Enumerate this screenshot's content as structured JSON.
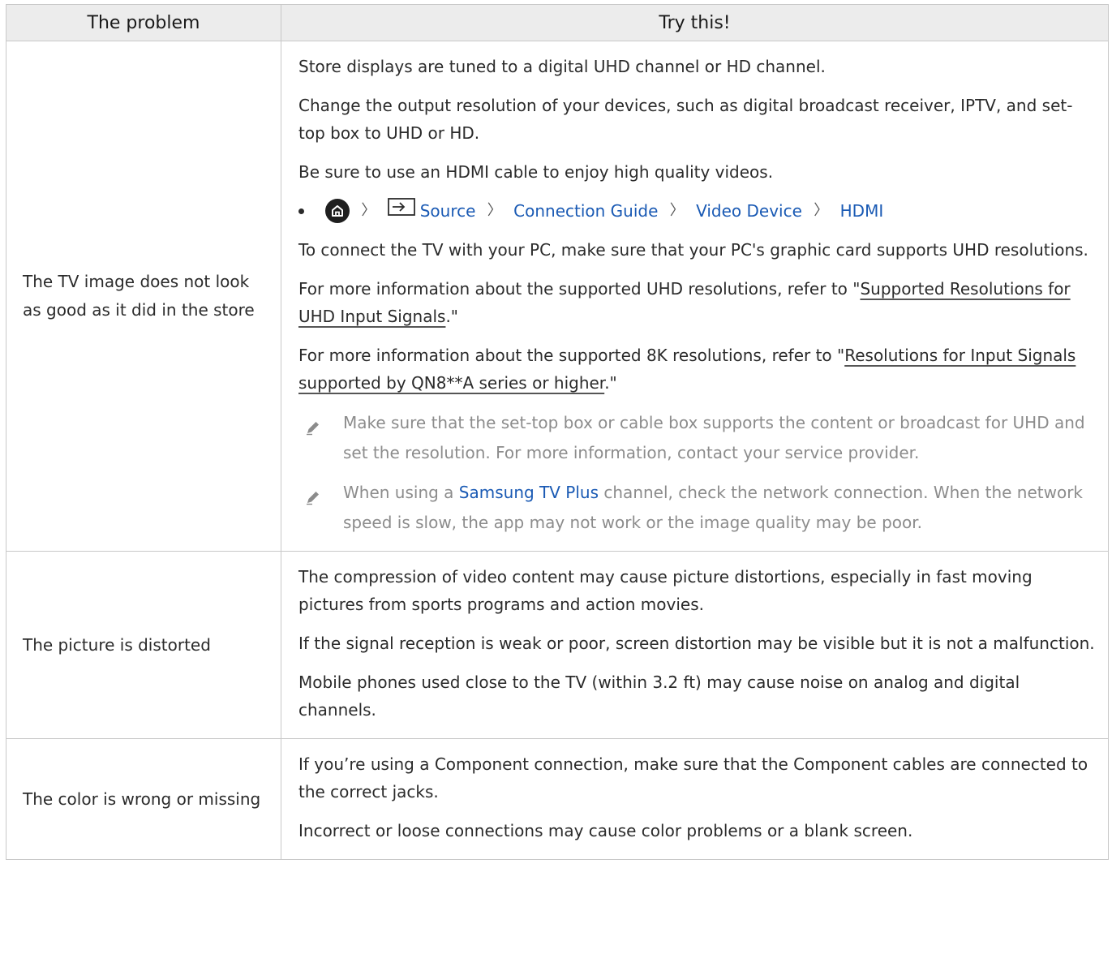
{
  "header": {
    "problem": "The problem",
    "try": "Try this!"
  },
  "rows": [
    {
      "problem": "The TV image does not look as good as it did in the store",
      "paras": [
        "Store displays are tuned to a digital UHD channel or HD channel.",
        "Change the output resolution of your devices, such as digital broadcast receiver, IPTV, and set-top box to UHD or HD.",
        "Be sure to use an HDMI cable to enjoy high quality videos."
      ],
      "menu_path": [
        "Source",
        "Connection Guide",
        "Video Device",
        "HDMI"
      ],
      "para_pc": "To connect the TV with your PC, make sure that your PC's graphic card supports UHD resolutions.",
      "uhd_prefix": "For more information about the supported UHD resolutions, refer to \"",
      "uhd_link": "Supported Resolutions for UHD Input Signals",
      "uhd_suffix": ".\"",
      "k8_prefix": "For more information about the supported 8K resolutions, refer to \"",
      "k8_link": "Resolutions for Input Signals supported by QN8**A series or higher",
      "k8_suffix": ".\"",
      "note1": "Make sure that the set-top box or cable box supports the content or broadcast for UHD and set the resolution. For more information, contact your service provider.",
      "note2_prefix": "When using a ",
      "note2_highlight": "Samsung TV Plus",
      "note2_suffix": " channel, check the network connection. When the network speed is slow, the app may not work or the image quality may be poor."
    },
    {
      "problem": "The picture is distorted",
      "paras": [
        "The compression of video content may cause picture distortions, especially in fast moving pictures from sports programs and action movies.",
        "If the signal reception is weak or poor, screen distortion may be visible but it is not a malfunction.",
        "Mobile phones used close to the TV (within 3.2 ft) may cause noise on analog and digital channels."
      ]
    },
    {
      "problem": "The color is wrong or missing",
      "paras": [
        "If you’re using a Component connection, make sure that the Component cables are connected to the correct jacks.",
        "Incorrect or loose connections may cause color problems or a blank screen."
      ]
    }
  ],
  "colors": {
    "link": "#1a5ab4",
    "note_text": "#8c8c8c",
    "header_bg": "#ececec",
    "border": "#c8c8c8"
  }
}
